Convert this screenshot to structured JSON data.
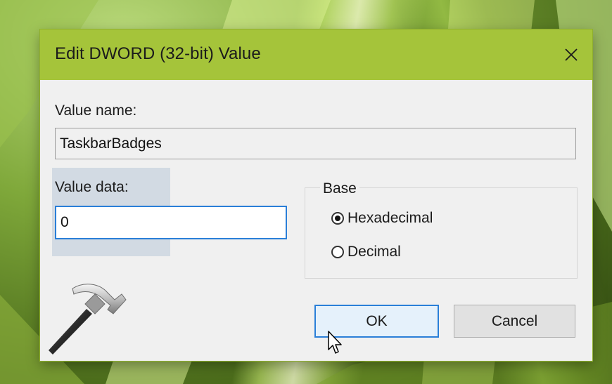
{
  "dialog": {
    "title": "Edit DWORD (32-bit) Value",
    "close_icon": "close-icon",
    "value_name_label": "Value name:",
    "value_name": "TaskbarBadges",
    "value_data_label": "Value data:",
    "value_data": "0",
    "base": {
      "label": "Base",
      "options": [
        {
          "label": "Hexadecimal",
          "selected": true
        },
        {
          "label": "Decimal",
          "selected": false
        }
      ]
    },
    "ok_label": "OK",
    "cancel_label": "Cancel"
  },
  "icons": {
    "logo": "hammer-icon",
    "pointer": "mouse-pointer-icon"
  },
  "colors": {
    "titlebar": "#a5c43a",
    "dialog_background": "#f0f0f0",
    "focus_border": "#2a7fd8",
    "ok_background": "#e5f1fb"
  }
}
